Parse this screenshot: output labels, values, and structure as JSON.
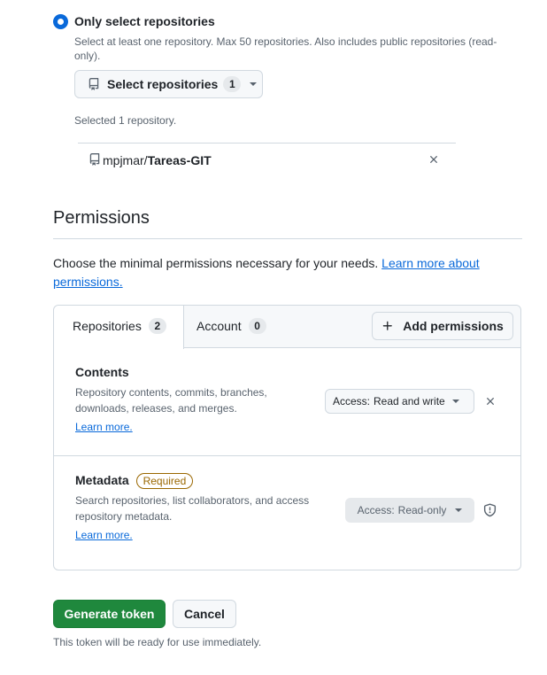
{
  "repo_access": {
    "option_label": "Only select repositories",
    "help": "Select at least one repository. Max 50 repositories. Also includes public repositories (read-only).",
    "select_button_label": "Select repositories",
    "select_button_count": "1",
    "selected_count_text": "Selected 1 repository.",
    "selected_repo": {
      "owner": "mpjmar/",
      "name": "Tareas-GIT"
    }
  },
  "permissions": {
    "title": "Permissions",
    "description": "Choose the minimal permissions necessary for your needs.",
    "learn_more_link": "Learn more about permissions.",
    "tabs": [
      {
        "label": "Repositories",
        "count": "2"
      },
      {
        "label": "Account",
        "count": "0"
      }
    ],
    "add_button": "Add permissions",
    "items": [
      {
        "title": "Contents",
        "description": "Repository contents, commits, branches, downloads, releases, and merges.",
        "learn_more": "Learn more.",
        "access_prefix": "Access:",
        "access_value": "Read and write",
        "icon": "close-icon"
      },
      {
        "title": "Metadata",
        "badge": "Required",
        "description": "Search repositories, list collaborators, and access repository metadata.",
        "learn_more": "Learn more.",
        "access_prefix": "Access:",
        "access_value": "Read-only",
        "icon": "shield-icon"
      }
    ]
  },
  "actions": {
    "generate": "Generate token",
    "cancel": "Cancel",
    "note": "This token will be ready for use immediately."
  },
  "colors": {
    "accent": "#0969da",
    "primary_button": "#1f883d",
    "required": "#9a6700"
  }
}
